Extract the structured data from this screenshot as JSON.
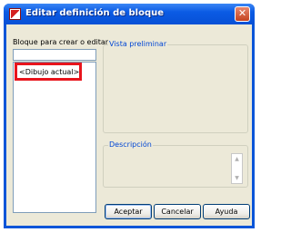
{
  "window": {
    "title": "Editar definición de bloque",
    "close_glyph": "✕"
  },
  "left_panel": {
    "label": "Bloque para crear o editar",
    "input_value": "",
    "list_items": [
      "<Dibujo actual>"
    ]
  },
  "preview_group": {
    "legend": "Vista preliminar"
  },
  "description_group": {
    "legend": "Descripción",
    "value": ""
  },
  "buttons": {
    "ok": "Aceptar",
    "cancel": "Cancelar",
    "help": "Ayuda"
  },
  "icons": {
    "app": "autocad-icon",
    "close": "close-icon",
    "scroll_up": "scroll-up-icon",
    "scroll_down": "scroll-down-icon"
  },
  "colors": {
    "titlebar": "#0b5be4",
    "highlight": "#e8141c",
    "legend": "#0046d5"
  }
}
